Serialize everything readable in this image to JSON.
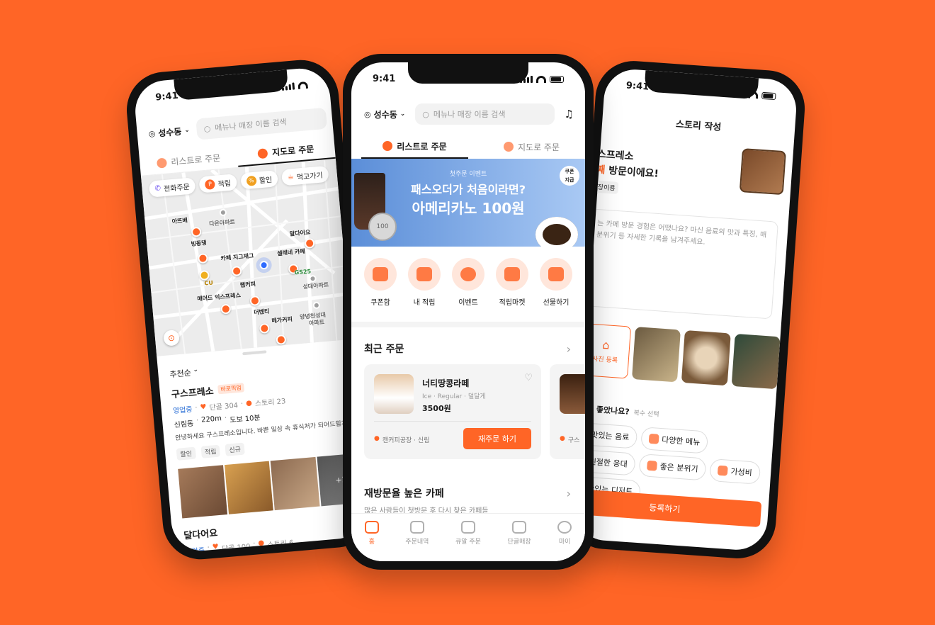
{
  "left": {
    "time": "9:41",
    "location": "성수동",
    "search_placeholder": "메뉴나 매장 이름 검색",
    "tabs": [
      "리스트로 주문",
      "지도로 주문"
    ],
    "filters": [
      "전화주문",
      "적립",
      "할인",
      "먹고가기"
    ],
    "map_labels": [
      "아뜨베",
      "다온아파트",
      "빙동댕",
      "카페 지그재그",
      "셀레네 카페",
      "달다어요",
      "CU",
      "GS25",
      "랩커피",
      "메머드 익스프레스",
      "성대아파트",
      "더벤티",
      "메가커피",
      "양녕천성대",
      "아파트"
    ],
    "sort": "추천순",
    "store1": {
      "name": "구스프레소",
      "badge": "바로픽업",
      "status": "영업중",
      "regulars": "단골 304",
      "stories": "스토리 23",
      "area": "신림동",
      "distance": "220m",
      "walk": "도보 10분",
      "desc": "안녕하세요 구스프레소입니다. 바쁜 일상 속 휴식처가 되어드릴게",
      "tags": [
        "할인",
        "적립",
        "신규"
      ],
      "more_photos": "+2"
    },
    "store2": {
      "name": "달다어요",
      "status": "영업중",
      "regulars": "단골 100",
      "stories": "스토리 6"
    }
  },
  "center": {
    "time": "9:41",
    "location": "성수동",
    "search_placeholder": "메뉴나 매장 이름 검색",
    "tabs": [
      "리스트로 주문",
      "지도로 주문"
    ],
    "banner": {
      "eyebrow": "첫주문 이벤트",
      "line1": "패스오더가 처음이라면?",
      "line2": "아메리카노 100원",
      "badge": "쿠폰\n지급",
      "coin": "100"
    },
    "quick_actions": [
      "쿠폰함",
      "내 적립",
      "이벤트",
      "적립마켓",
      "선물하기"
    ],
    "recent_title": "최근 주문",
    "recent_item": {
      "name": "너티땅콩라떼",
      "options": "Ice · Regular · 덜달게",
      "price": "3500원",
      "store": "캔커피공장 · 신림",
      "reorder_label": "재주문 하기"
    },
    "second_card_store": "구스",
    "revisit_title": "재방문율 높은 카페",
    "revisit_sub": "많은 사람들이 첫방문 후 다시 찾은 카페들",
    "bottom_nav": [
      "홈",
      "주문내역",
      "큐알 주문",
      "단골매장",
      "마이"
    ]
  },
  "right": {
    "time": "9:41",
    "title": "스토리 작성",
    "store": "스프레소",
    "visit_num": "째",
    "visit_text": " 방문이에요!",
    "visit_type": "장이용",
    "placeholder": "는 카페 방문 경험은 어땠나요? 마신 음료의 맛과 특징, 매 분위기 등 자세한 기록을 남겨주세요.",
    "photo_label": "사진 등록",
    "question": "점이 좋았나요?",
    "question_sub": "복수 선택",
    "prefs": [
      "맛있는 음료",
      "다양한 메뉴",
      "친절한 응대",
      "좋은 분위기",
      "가성비",
      "맛있는 디저트"
    ],
    "submit_label": "등록하기"
  },
  "colors": {
    "background": "#FF6526",
    "accent": "#FF6526",
    "accent_light": "#FFE6DB",
    "link_blue": "#2b6fd6"
  }
}
